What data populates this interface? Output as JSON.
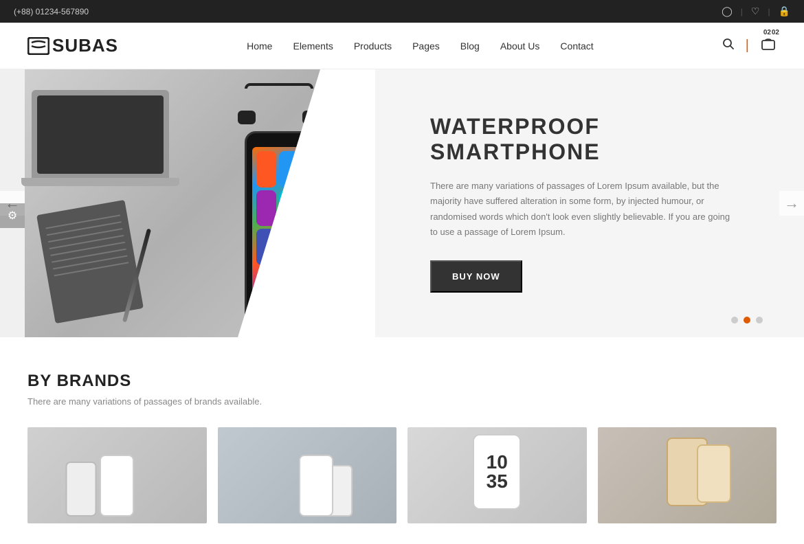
{
  "topbar": {
    "phone": "(+88) 01234-567890",
    "icons": [
      "user-icon",
      "heart-icon",
      "lock-icon"
    ]
  },
  "header": {
    "logo_text": "SUBAS",
    "nav_items": [
      {
        "label": "Home",
        "href": "#"
      },
      {
        "label": "Elements",
        "href": "#"
      },
      {
        "label": "Products",
        "href": "#"
      },
      {
        "label": "Pages",
        "href": "#"
      },
      {
        "label": "Blog",
        "href": "#"
      },
      {
        "label": "About Us",
        "href": "#"
      },
      {
        "label": "Contact",
        "href": "#"
      }
    ],
    "cart_count": "02"
  },
  "hero": {
    "title": "WATERPROOF SMARTPHONE",
    "description": "There are many variations of passages of Lorem Ipsum available, but the majority have suffered alteration in some form, by injected humour, or randomised words which don't look even slightly believable. If you are going to use a passage of Lorem Ipsum.",
    "button_label": "BUY NOW",
    "dots": [
      1,
      2,
      3
    ],
    "active_dot": 1
  },
  "brands": {
    "title": "BY BRANDS",
    "description": "There are many variations of passages of brands available.",
    "cards": [
      {
        "id": 1,
        "bg": "card1"
      },
      {
        "id": 2,
        "bg": "card2"
      },
      {
        "id": 3,
        "bg": "card3"
      },
      {
        "id": 4,
        "bg": "card4"
      }
    ]
  }
}
